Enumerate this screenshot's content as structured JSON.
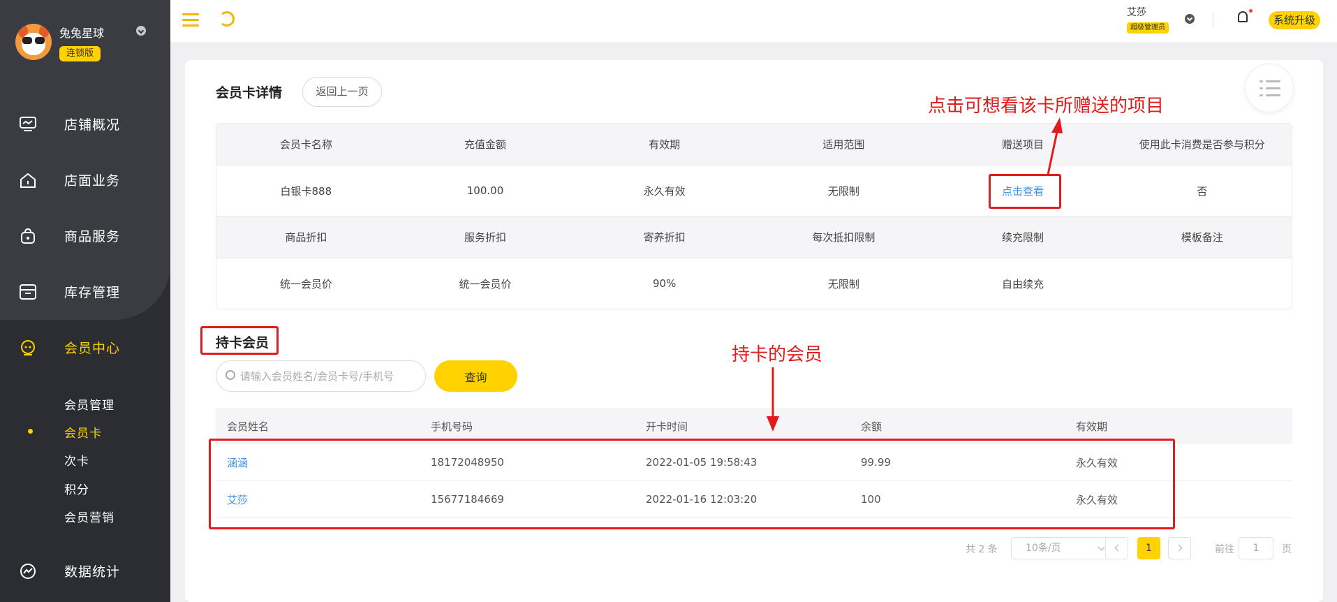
{
  "sidebar": {
    "shop_name": "兔兔星球",
    "shop_badge": "连锁版",
    "menu": [
      {
        "label": "店铺概况",
        "icon": "monitor-icon"
      },
      {
        "label": "店面业务",
        "icon": "home-icon"
      },
      {
        "label": "商品服务",
        "icon": "bag-icon"
      },
      {
        "label": "库存管理",
        "icon": "box-icon"
      },
      {
        "label": "会员中心",
        "icon": "member-icon"
      },
      {
        "label": "数据统计",
        "icon": "chart-icon"
      }
    ],
    "sub_menu": [
      "会员管理",
      "会员卡",
      "次卡",
      "积分",
      "会员营销"
    ],
    "active_color": "#ffd200"
  },
  "header": {
    "user_name": "艾莎",
    "user_role": "超级管理员",
    "upgrade_label": "系统升级"
  },
  "page": {
    "title": "会员卡详情",
    "back_label": "返回上一页"
  },
  "card_detail": {
    "headers_1": [
      "会员卡名称",
      "充值金额",
      "有效期",
      "适用范围",
      "赠送项目",
      "使用此卡消费是否参与积分"
    ],
    "values_1": [
      "白银卡888",
      "100.00",
      "永久有效",
      "无限制",
      "点击查看",
      "否"
    ],
    "headers_2": [
      "商品折扣",
      "服务折扣",
      "寄养折扣",
      "每次抵扣限制",
      "续充限制",
      "模板备注"
    ],
    "values_2": [
      "统一会员价",
      "统一会员价",
      "90%",
      "无限制",
      "自由续充",
      ""
    ]
  },
  "members": {
    "title": "持卡会员",
    "search_placeholder": "请输入会员姓名/会员卡号/手机号",
    "query_label": "查询",
    "columns": [
      "会员姓名",
      "手机号码",
      "开卡时间",
      "余额",
      "有效期"
    ],
    "rows": [
      [
        "涵涵",
        "18172048950",
        "2022-01-05 19:58:43",
        "99.99",
        "永久有效"
      ],
      [
        "艾莎",
        "15677184669",
        "2022-01-16 12:03:20",
        "100",
        "永久有效"
      ]
    ]
  },
  "pagination": {
    "total": "共 2 条",
    "page_size": "10条/页",
    "current": "1",
    "goto_label": "前往",
    "goto_value": "1",
    "page_suffix": "页"
  },
  "annotations": {
    "gift_note": "点击可想看该卡所赠送的项目",
    "members_note": "持卡的会员",
    "color": "#e21b1b"
  }
}
